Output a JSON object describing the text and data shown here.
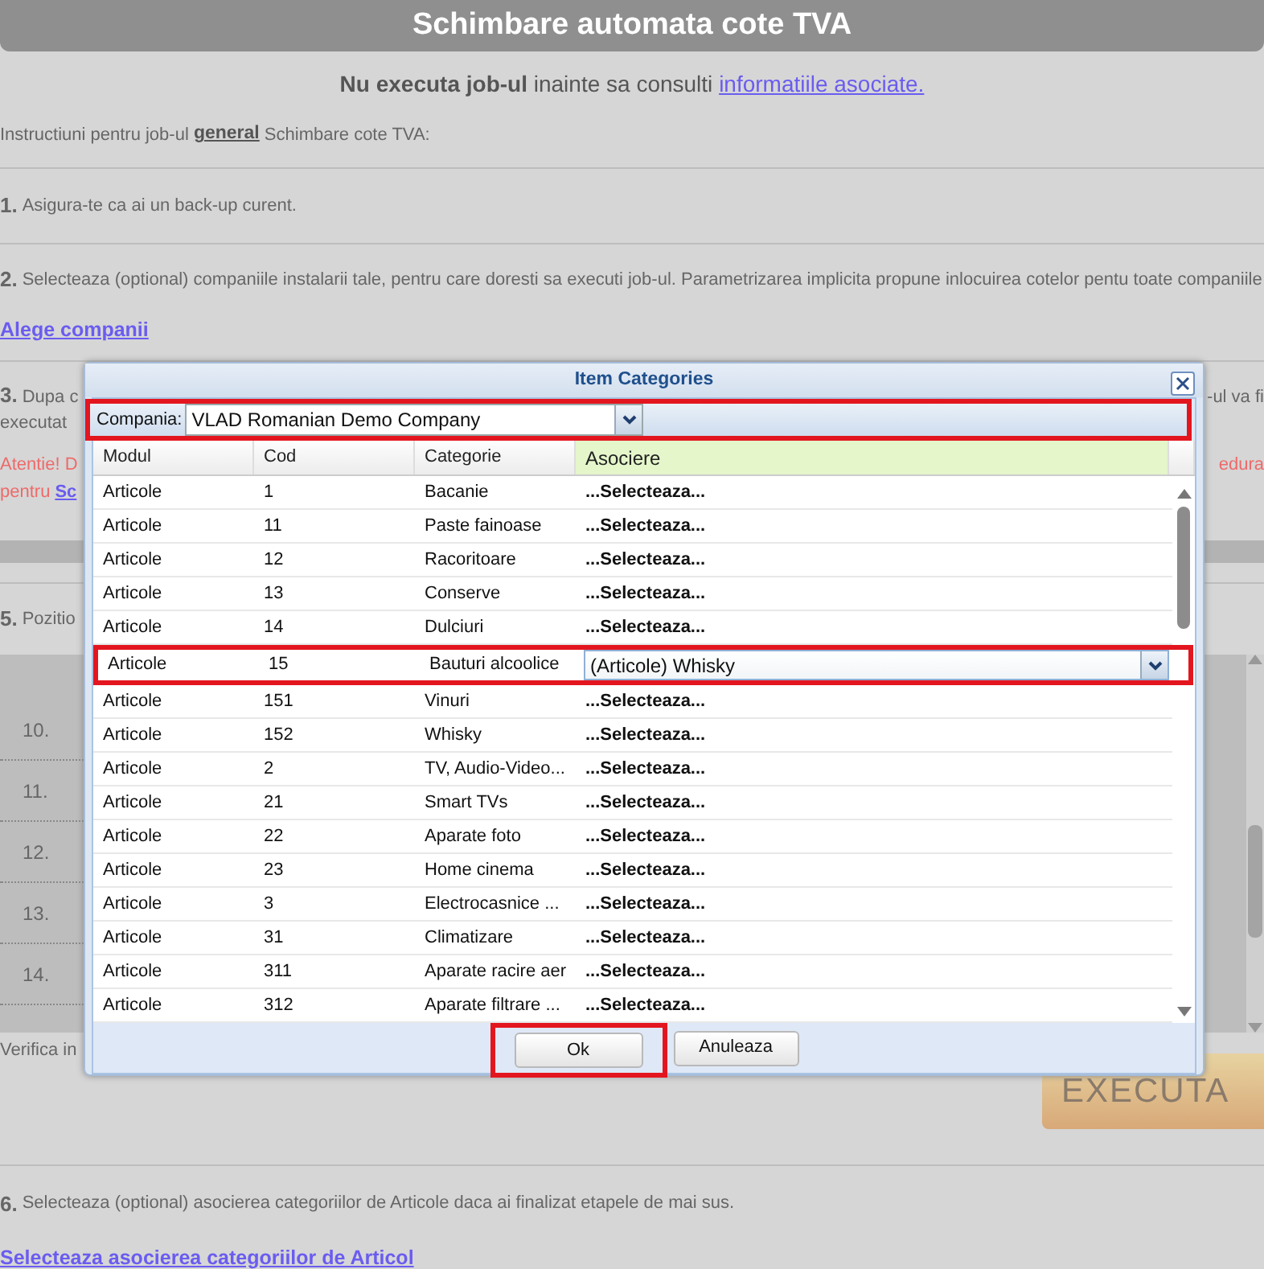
{
  "page": {
    "title": "Schimbare automata cote TVA",
    "notice": "**Nu executa job-ul** inainte sa consulti",
    "notice_link": "informatiile asociate.",
    "intro_before": "Instructiuni pentru job-ul",
    "intro_link": "general",
    "intro_after": "Schimbare cote TVA:",
    "step_1": {
      "number": "1.",
      "text": "Asigura-te ca ai un back-up curent."
    },
    "step_2": {
      "number": "2.",
      "text": "Selecteaza (optional) companiile instalarii tale, pentru care doresti sa executi job-ul. Parametrizarea implicita propune inlocuirea cotelor pentu toate companiile",
      "link": "Alege companii"
    },
    "step_3": {
      "number": "3.",
      "fragment_left": "Dupa c",
      "fragment_right": "-ul va fi",
      "line_2": "executat",
      "warning_left": "Atentie! D",
      "warning_right": "edura",
      "warning_line_2": "pentru",
      "warning_link": "Sc"
    },
    "step_5": {
      "number": "5.",
      "fragment": "Pozitio",
      "list_numbers": [
        "10.",
        "11.",
        "12.",
        "13.",
        "14."
      ],
      "verify_fragment": "Verifica in",
      "execute_button": "EXECUTA"
    },
    "step_6": {
      "number": "6.",
      "text": "Selecteaza (optional) asocierea categoriilor de Articole daca ai finalizat etapele de mai sus.",
      "link": "Selecteaza asocierea categoriilor de Articol"
    }
  },
  "dialog": {
    "title": "Item Categories",
    "company_label": "Compania:",
    "company_value": "VLAD Romanian Demo Company",
    "company_highlighted": true,
    "columns": [
      "Modul",
      "Cod",
      "Categorie",
      "Asociere"
    ],
    "rows": [
      {
        "module": "Articole",
        "code": "1",
        "category": "Bacanie",
        "kind": "text",
        "association": "...Selecteaza...",
        "highlighted": false
      },
      {
        "module": "Articole",
        "code": "11",
        "category": "Paste fainoase",
        "kind": "text",
        "association": "...Selecteaza...",
        "highlighted": false
      },
      {
        "module": "Articole",
        "code": "12",
        "category": "Racoritoare",
        "kind": "text",
        "association": "...Selecteaza...",
        "highlighted": false
      },
      {
        "module": "Articole",
        "code": "13",
        "category": "Conserve",
        "kind": "text",
        "association": "...Selecteaza...",
        "highlighted": false
      },
      {
        "module": "Articole",
        "code": "14",
        "category": "Dulciuri",
        "kind": "text",
        "association": "...Selecteaza...",
        "highlighted": false
      },
      {
        "module": "Articole",
        "code": "15",
        "category": "Bauturi alcoolice",
        "kind": "select",
        "association": "(Articole) Whisky",
        "highlighted": true
      },
      {
        "module": "Articole",
        "code": "151",
        "category": "Vinuri",
        "kind": "text",
        "association": "...Selecteaza...",
        "highlighted": false
      },
      {
        "module": "Articole",
        "code": "152",
        "category": "Whisky",
        "kind": "text",
        "association": "...Selecteaza...",
        "highlighted": false
      },
      {
        "module": "Articole",
        "code": "2",
        "category": "TV, Audio-Video...",
        "kind": "text",
        "association": "...Selecteaza...",
        "highlighted": false
      },
      {
        "module": "Articole",
        "code": "21",
        "category": "Smart TVs",
        "kind": "text",
        "association": "...Selecteaza...",
        "highlighted": false
      },
      {
        "module": "Articole",
        "code": "22",
        "category": "Aparate foto",
        "kind": "text",
        "association": "...Selecteaza...",
        "highlighted": false
      },
      {
        "module": "Articole",
        "code": "23",
        "category": "Home cinema",
        "kind": "text",
        "association": "...Selecteaza...",
        "highlighted": false
      },
      {
        "module": "Articole",
        "code": "3",
        "category": "Electrocasnice ...",
        "kind": "text",
        "association": "...Selecteaza...",
        "highlighted": false
      },
      {
        "module": "Articole",
        "code": "31",
        "category": "Climatizare",
        "kind": "text",
        "association": "...Selecteaza...",
        "highlighted": false
      },
      {
        "module": "Articole",
        "code": "311",
        "category": "Aparate racire aer",
        "kind": "text",
        "association": "...Selecteaza...",
        "highlighted": false
      },
      {
        "module": "Articole",
        "code": "312",
        "category": "Aparate filtrare ...",
        "kind": "text",
        "association": "...Selecteaza...",
        "highlighted": false
      }
    ],
    "buttons": [
      {
        "label": "Ok",
        "highlighted": true
      },
      {
        "label": "Anuleaza",
        "highlighted": false
      }
    ]
  }
}
